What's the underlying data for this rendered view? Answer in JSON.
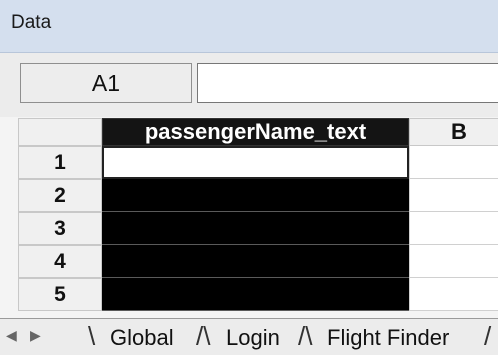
{
  "panel": {
    "title": "Data"
  },
  "namebox": {
    "value": "A1"
  },
  "formula": {
    "value": ""
  },
  "columns": [
    {
      "label": "passengerName_text"
    },
    {
      "label": "B"
    }
  ],
  "rows": [
    {
      "num": "1"
    },
    {
      "num": "2"
    },
    {
      "num": "3"
    },
    {
      "num": "4"
    },
    {
      "num": "5"
    }
  ],
  "sheet_tabs": [
    {
      "label": "Global"
    },
    {
      "label": "Login"
    },
    {
      "label": "Flight Finder"
    }
  ],
  "icons": {
    "scroll_left": "triangle-left-icon",
    "scroll_right": "triangle-right-icon"
  }
}
